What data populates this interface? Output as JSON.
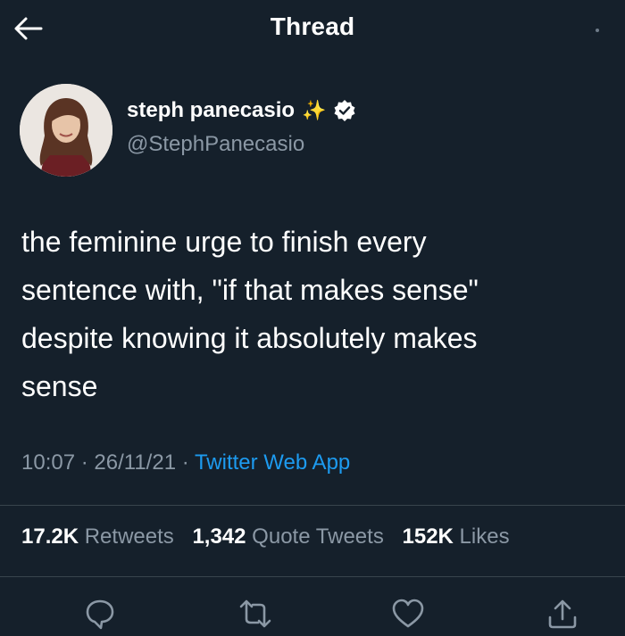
{
  "header": {
    "title": "Thread",
    "back_icon": "arrow-left-icon"
  },
  "author": {
    "display_name": "steph panecasio",
    "emoji": "✨",
    "verified_icon": "verified-badge-icon",
    "handle": "@StephPanecasio"
  },
  "tweet": {
    "text": "the feminine urge to finish every\nsentence with, \"if that makes sense\"\ndespite knowing it absolutely makes\nsense",
    "time": "10:07",
    "date": "26/11/21",
    "separator": "·",
    "source": "Twitter Web App"
  },
  "stats": {
    "retweets_count": "17.2K",
    "retweets_label": "Retweets",
    "quotes_count": "1,342",
    "quotes_label": "Quote Tweets",
    "likes_count": "152K",
    "likes_label": "Likes"
  },
  "actions": {
    "reply_icon": "reply-icon",
    "retweet_icon": "retweet-icon",
    "like_icon": "heart-icon",
    "share_icon": "share-icon"
  },
  "colors": {
    "background": "#15202b",
    "text": "#ffffff",
    "secondary": "#8b98a5",
    "link": "#1d9bf0",
    "divider": "#38444d"
  }
}
